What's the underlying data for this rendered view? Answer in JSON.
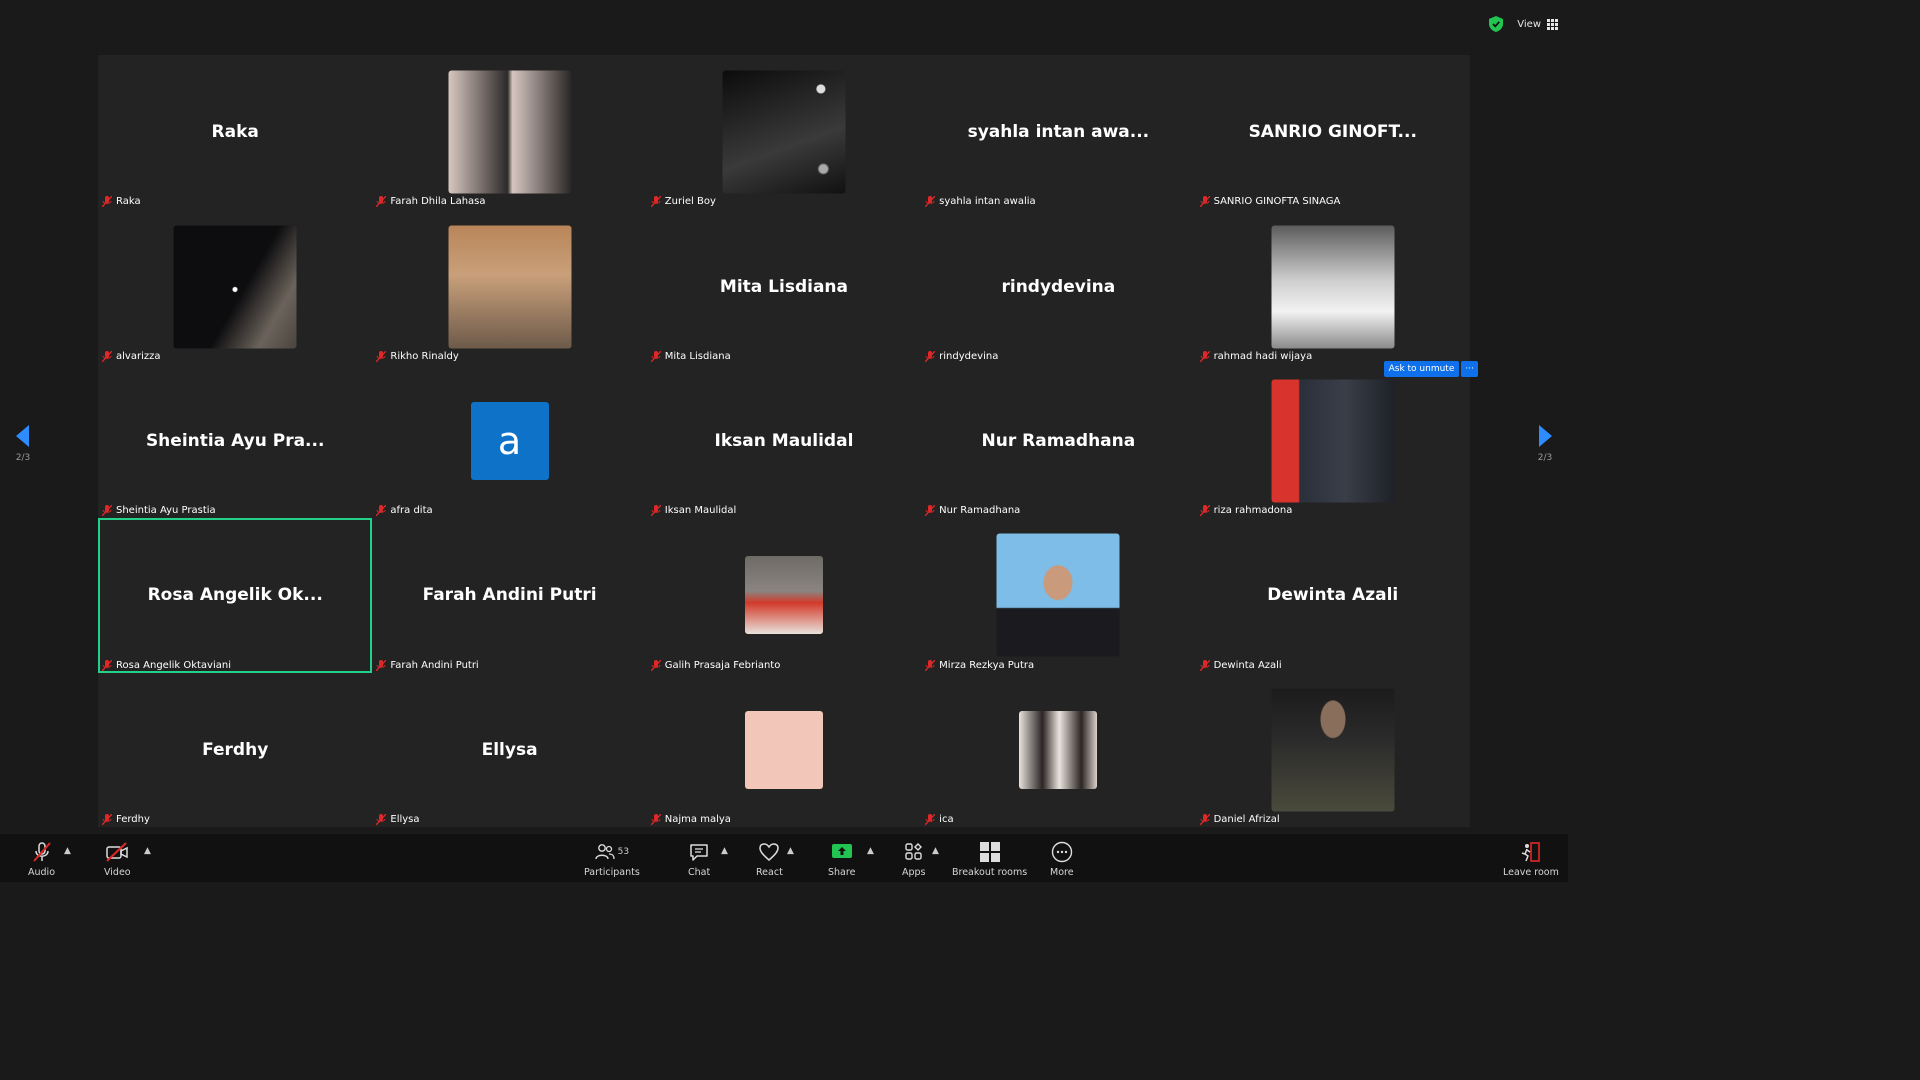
{
  "topbar": {
    "view_label": "View"
  },
  "pagination": {
    "left": "2/3",
    "right": "2/3"
  },
  "tiles": [
    {
      "big": "Raka",
      "label": "Raka"
    },
    {
      "big": "",
      "label": "Farah Dhila Lahasa"
    },
    {
      "big": "",
      "label": "Zuriel Boy"
    },
    {
      "big": "syahla intan awa...",
      "label": "syahla intan awalia"
    },
    {
      "big": "SANRIO GINOFT...",
      "label": "SANRIO GINOFTA SINAGA"
    },
    {
      "big": "",
      "label": "alvarizza"
    },
    {
      "big": "",
      "label": "Rikho Rinaldy"
    },
    {
      "big": "Mita Lisdiana",
      "label": "Mita Lisdiana"
    },
    {
      "big": "rindydevina",
      "label": "rindydevina"
    },
    {
      "big": "",
      "label": "rahmad hadi wijaya"
    },
    {
      "big": "Sheintia Ayu Pra...",
      "label": "Sheintia Ayu Prastia"
    },
    {
      "big": "",
      "label": "afra dita",
      "letter": "a"
    },
    {
      "big": "Iksan Maulidal",
      "label": "Iksan Maulidal"
    },
    {
      "big": "Nur Ramadhana",
      "label": "Nur Ramadhana"
    },
    {
      "big": "",
      "label": "riza rahmadona"
    },
    {
      "big": "Rosa Angelik Ok...",
      "label": "Rosa Angelik Oktaviani"
    },
    {
      "big": "Farah Andini Putri",
      "label": "Farah Andini Putri"
    },
    {
      "big": "",
      "label": "Galih Prasaja Febrianto"
    },
    {
      "big": "",
      "label": "Mirza Rezkya Putra"
    },
    {
      "big": "Dewinta Azali",
      "label": "Dewinta Azali"
    },
    {
      "big": "Ferdhy",
      "label": "Ferdhy"
    },
    {
      "big": "Ellysa",
      "label": "Ellysa"
    },
    {
      "big": "",
      "label": "Najma malya"
    },
    {
      "big": "",
      "label": "ica"
    },
    {
      "big": "",
      "label": "Daniel Afrizal"
    }
  ],
  "ask_unmute": {
    "label": "Ask to unmute",
    "more": "···"
  },
  "toolbar": {
    "audio": "Audio",
    "video": "Video",
    "participants": "Participants",
    "participants_count": "53",
    "chat": "Chat",
    "react": "React",
    "share": "Share",
    "apps": "Apps",
    "breakout": "Breakout rooms",
    "more": "More",
    "leave": "Leave room"
  },
  "colors": {
    "active_speaker": "#23d18b",
    "accent_blue": "#0e71eb",
    "mute_red": "#e02828",
    "share_green": "#23c552"
  }
}
